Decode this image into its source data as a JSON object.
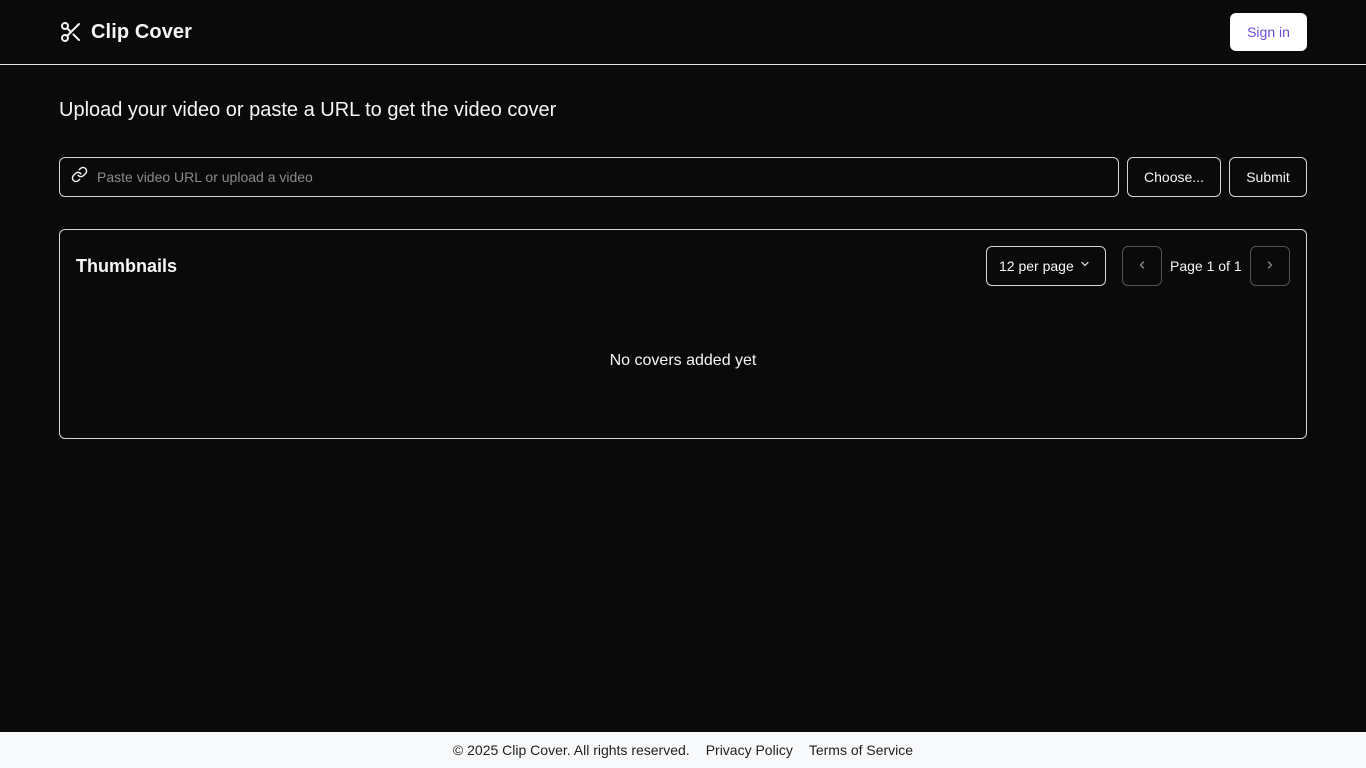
{
  "header": {
    "brand_name": "Clip Cover",
    "brand_icon": "scissors-icon",
    "signin_label": "Sign in"
  },
  "main": {
    "headline": "Upload your video or paste a URL to get the video cover",
    "url_input": {
      "icon": "link-icon",
      "placeholder": "Paste video URL or upload a video",
      "value": ""
    },
    "choose_label": "Choose...",
    "submit_label": "Submit"
  },
  "thumbnails": {
    "title": "Thumbnails",
    "per_page_label": "12 per page",
    "page_info": "Page 1 of 1",
    "empty_message": "No covers added yet"
  },
  "footer": {
    "copyright": "© 2025 Clip Cover. All rights reserved.",
    "privacy": "Privacy Policy",
    "terms": "Terms of Service"
  },
  "colors": {
    "background": "#0a0a0a",
    "text": "#f5f5f5",
    "signin_text": "#6d4bd8",
    "footer_bg": "#f8f9fb"
  }
}
